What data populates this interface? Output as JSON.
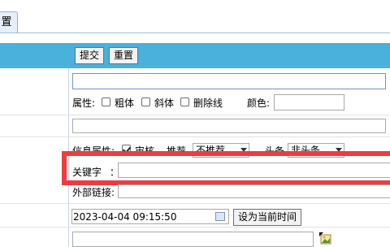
{
  "tab": {
    "label": "置"
  },
  "toolbar": {
    "submit_label": "提交",
    "reset_label": "重置"
  },
  "attributes": {
    "label": "属性:",
    "bold": "粗体",
    "italic": "斜体",
    "strike": "删除线",
    "color_label": "颜色:"
  },
  "info_attrs": {
    "label": "信息属性:",
    "audit": "审核",
    "recommend_label": "推荐",
    "recommend_value": "不推荐",
    "headline_label": "头条",
    "headline_value": "非头条"
  },
  "keyword": {
    "label": "关键字",
    "colon": "："
  },
  "external_link": {
    "label": "外部链接:"
  },
  "datetime": {
    "value": "2023-04-04 09:15:50",
    "set_now_label": "设为当前时间"
  },
  "colors": {
    "toolbar": "#4ab0dc",
    "highlight": "#ef3b3f"
  }
}
